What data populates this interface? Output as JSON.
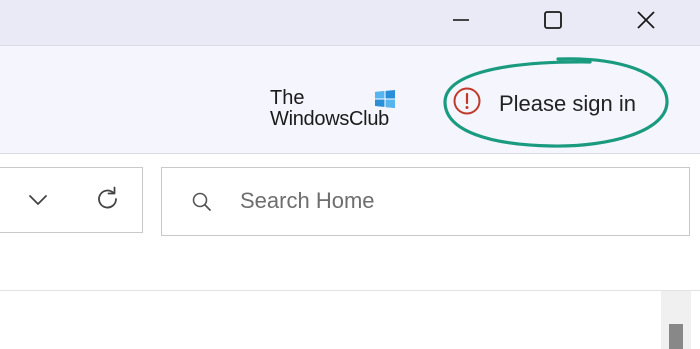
{
  "titlebar": {
    "minimize_icon": "minimize-icon",
    "maximize_icon": "maximize-icon",
    "close_icon": "close-icon"
  },
  "header": {
    "watermark": {
      "line1": "The",
      "line2": "WindowsClub"
    },
    "signin": {
      "label": "Please sign in",
      "icon": "alert-icon",
      "icon_color": "#c0392b",
      "highlight_color": "#1a9b80"
    }
  },
  "toolbar": {
    "dropdown_icon": "chevron-down-icon",
    "refresh_icon": "refresh-icon",
    "search": {
      "icon": "search-icon",
      "placeholder": "Search Home",
      "value": ""
    }
  }
}
